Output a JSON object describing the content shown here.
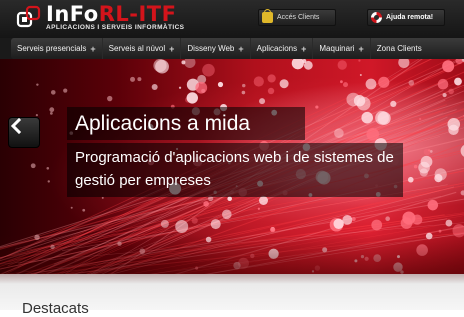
{
  "header": {
    "logo": {
      "title_part1": "InFo",
      "title_part2": "RL-ITF",
      "subtitle": "APLICACIONS I SERVEIS INFORMÀTICS"
    },
    "clients_button": {
      "label": "Accés Clients",
      "icon": "lock-icon"
    },
    "remote_button": {
      "label": "Ajuda remota!",
      "icon": "lifebuoy-icon"
    }
  },
  "nav": {
    "items": [
      {
        "label": "Serveis presencials",
        "submenu": "+"
      },
      {
        "label": "Serveis al núvol",
        "submenu": "+"
      },
      {
        "label": "Disseny Web",
        "submenu": "+"
      },
      {
        "label": "Aplicacions",
        "submenu": "+"
      },
      {
        "label": "Maquinari",
        "submenu": "+"
      },
      {
        "label": "Zona Clients",
        "submenu": ""
      }
    ]
  },
  "hero": {
    "title": "Aplicacions a mida",
    "description": "Programació d'aplicacions web i de sistemes de gestió per empreses",
    "prev_icon": "chevron-left-icon"
  },
  "section": {
    "title": "Destacats"
  },
  "colors": {
    "brand_red": "#d3141b",
    "dark": "#1d1d1d"
  }
}
